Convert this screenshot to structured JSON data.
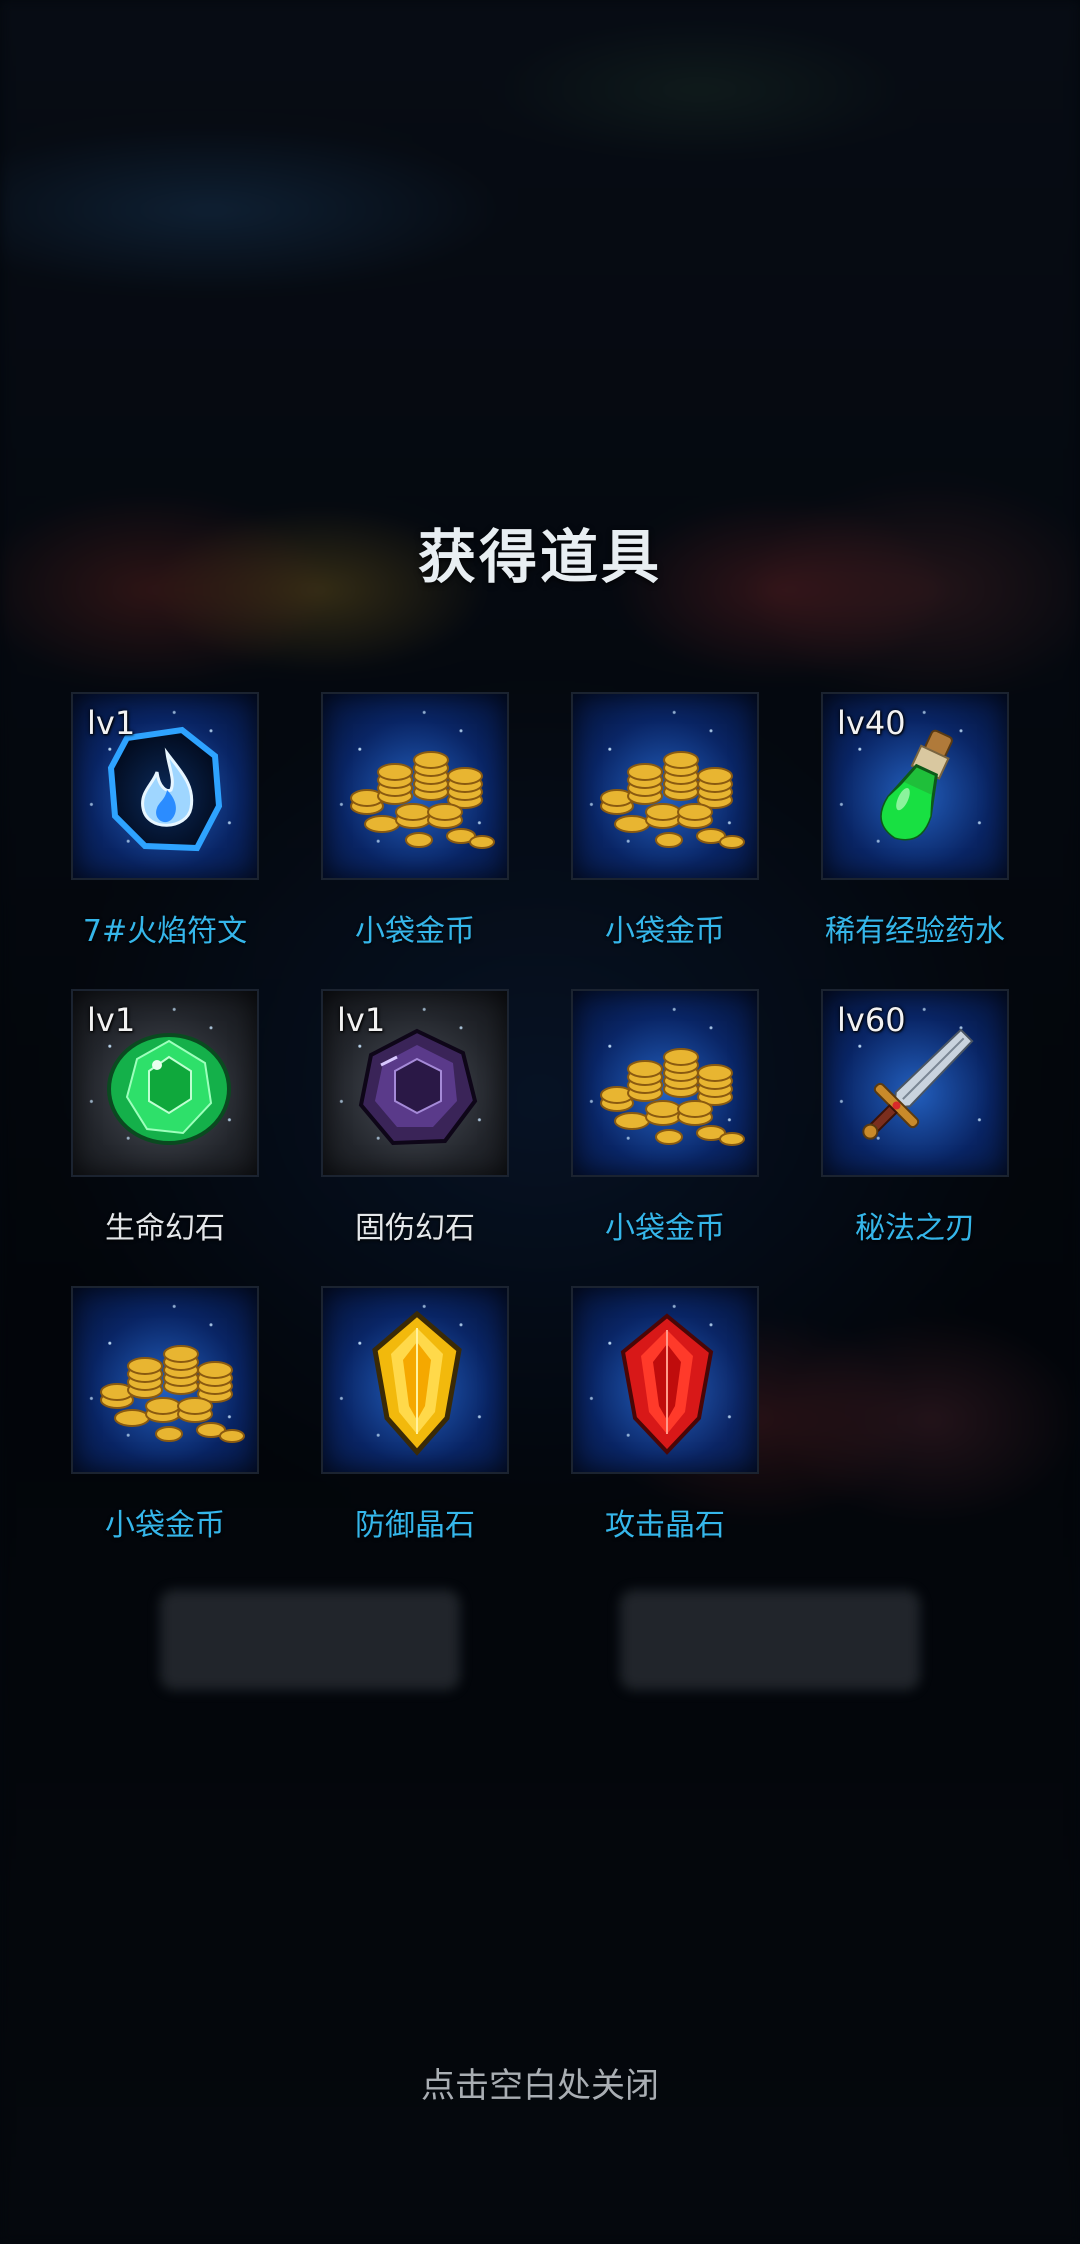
{
  "dialog": {
    "title": "获得道具",
    "close_hint": "点击空白处关闭"
  },
  "items": [
    {
      "icon": "fire-rune-icon",
      "level": "lv1",
      "name": "7#火焰符文",
      "name_color": "#35b6ea"
    },
    {
      "icon": "gold-coins-icon",
      "level": "",
      "name": "小袋金币",
      "name_color": "#35b6ea"
    },
    {
      "icon": "gold-coins-icon",
      "level": "",
      "name": "小袋金币",
      "name_color": "#35b6ea"
    },
    {
      "icon": "exp-potion-icon",
      "level": "lv40",
      "name": "稀有经验药水",
      "name_color": "#35b6ea"
    },
    {
      "icon": "green-gem-icon",
      "level": "lv1",
      "name": "生命幻石",
      "name_color": "#e4e7ea"
    },
    {
      "icon": "purple-gem-icon",
      "level": "lv1",
      "name": "固伤幻石",
      "name_color": "#e4e7ea"
    },
    {
      "icon": "gold-coins-icon",
      "level": "",
      "name": "小袋金币",
      "name_color": "#35b6ea"
    },
    {
      "icon": "sword-icon",
      "level": "lv60",
      "name": "秘法之刃",
      "name_color": "#35b6ea"
    },
    {
      "icon": "gold-coins-icon",
      "level": "",
      "name": "小袋金币",
      "name_color": "#35b6ea"
    },
    {
      "icon": "yellow-crystal-icon",
      "level": "",
      "name": "防御晶石",
      "name_color": "#35b6ea"
    },
    {
      "icon": "red-crystal-icon",
      "level": "",
      "name": "攻击晶石",
      "name_color": "#35b6ea"
    }
  ]
}
